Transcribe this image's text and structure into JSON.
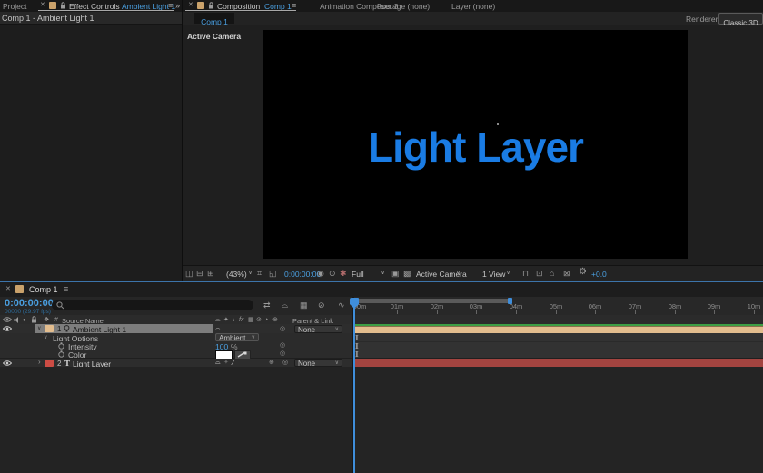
{
  "colors": {
    "accent_blue": "#3f8edb",
    "timecode_blue": "#4a9fe0",
    "title_blue": "#1a7ce4",
    "label_peach": "#e3bd8e",
    "label_red": "#cc4c44",
    "cache_green": "#3d9e44",
    "bar_maroon": "#a34440"
  },
  "icons": {
    "close": "✕",
    "menu": "≡",
    "chevron_down": "∨",
    "chevron_right": "›",
    "double_chevron": "»",
    "gear": "⚙",
    "pickwhip": "◎",
    "solo": "●",
    "grid": "⌗",
    "rulers": "◱",
    "snapshot": "◉",
    "ghost": "⊙",
    "channels": "✱",
    "roi": "▣",
    "transparency": "▩",
    "monitor_a": "◫",
    "monitor_b": "⊟",
    "monitor_c": "⊞",
    "layout_a": "⊓",
    "layout_b": "⊡",
    "layout_c": "⌂",
    "layout_d": "⊠",
    "shy": "⌓",
    "collapse": "✦",
    "quality": "\\",
    "fx": "fx",
    "frame_blend": "▦",
    "motion_blur": "⊘",
    "adjustment": "◔",
    "cube": "⊕",
    "label_col": "❖",
    "hash": "#",
    "swap": "⇄",
    "wave": "∿",
    "plus_circle": "⊕",
    "quality_slash": "∕",
    "ibeam": "I",
    "text_layer": "T"
  },
  "top": {
    "project_tab": "Project",
    "effect_controls_tab": "Effect Controls",
    "effect_controls_target": "Ambient Light 1",
    "left_header": "Comp 1 - Ambient Light 1",
    "composition_tab": "Composition",
    "composition_target": "Comp 1",
    "animation_composer_tab": "Animation Composer 3",
    "footage_tab": "Footage  (none)",
    "layer_tab": "Layer  (none)",
    "renderer_label": "Renderer:",
    "renderer_value": "Classic 3D"
  },
  "viewer": {
    "subtab": "Comp 1",
    "camera_label": "Active Camera",
    "title": "Light Layer"
  },
  "comp_toolbar": {
    "zoom": "(43%)",
    "timecode": "0:00:00:00",
    "resolution": "Full",
    "camera": "Active Camera",
    "view": "1 View",
    "exposure": "+0.0"
  },
  "timeline": {
    "tab": "Comp 1",
    "timecode": "0:00:00:00",
    "frames": "00000 (29.97 fps)",
    "columns": {
      "source": "Source Name",
      "parent": "Parent & Link"
    },
    "ruler": [
      "00m",
      "01m",
      "02m",
      "03m",
      "04m",
      "05m",
      "06m",
      "07m",
      "08m",
      "09m",
      "10m"
    ],
    "layer1": {
      "num": "1",
      "name": "Ambient Light 1",
      "parent": "None"
    },
    "group": {
      "name": "Light Options",
      "mode": "Ambient"
    },
    "intensity": {
      "name": "Intensity",
      "value": "100",
      "unit": "%"
    },
    "color_prop": {
      "name": "Color"
    },
    "layer2": {
      "num": "2",
      "name": "Light Layer",
      "parent": "None"
    }
  }
}
